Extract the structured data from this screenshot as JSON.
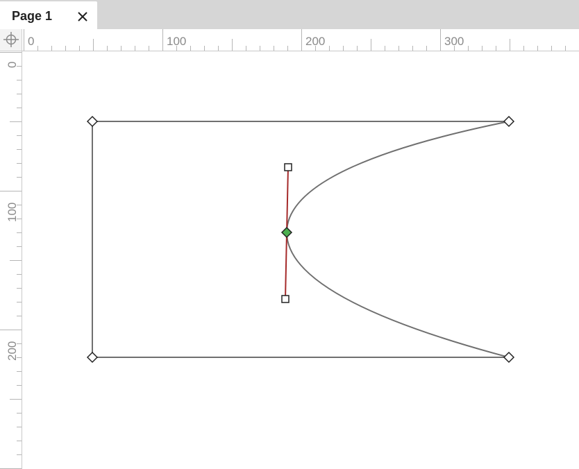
{
  "tabs": [
    {
      "label": "Page 1",
      "active": true
    }
  ],
  "ruler": {
    "horizontal_labels": [
      "0",
      "100",
      "200",
      "300"
    ],
    "vertical_labels": [
      "0",
      "100",
      "200"
    ]
  },
  "icons": {
    "tab_close": "close-icon",
    "ruler_origin": "crosshair-icon",
    "vertex": "diamond-handle-icon",
    "control_point": "square-handle-icon",
    "selected_vertex": "selected-diamond-handle-icon"
  },
  "colors": {
    "shape_stroke": "#6f6f6f",
    "handle_line": "#a52a2a",
    "selected_vertex_fill": "#4caf50",
    "tabbar_bg": "#d6d6d6"
  }
}
